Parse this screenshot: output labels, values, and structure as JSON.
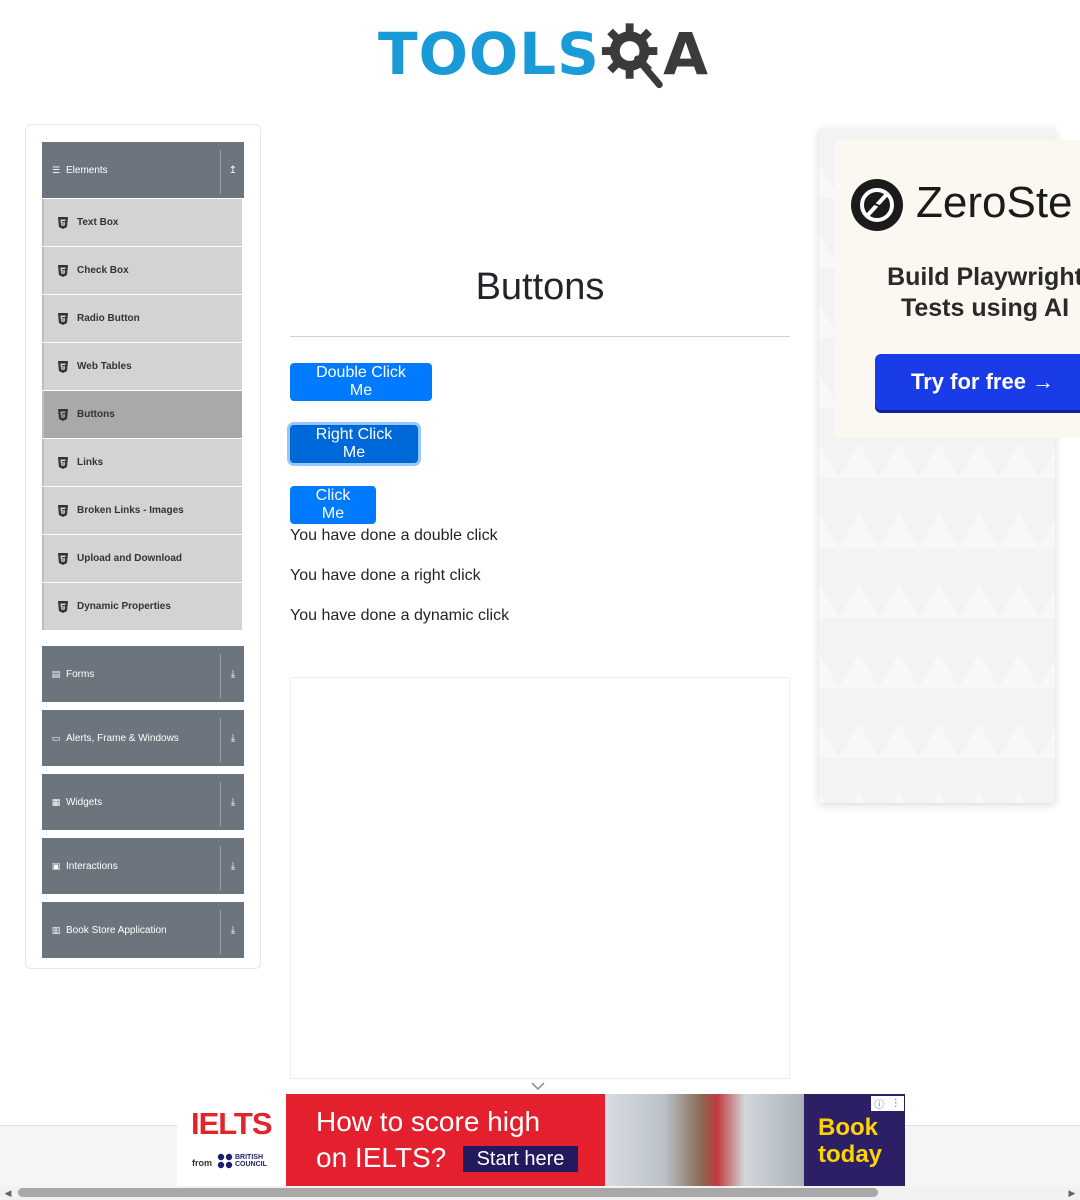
{
  "header": {
    "logo_text": "TOOLS",
    "logo_text_end": "A"
  },
  "sidebar": {
    "groups": [
      {
        "label": "Elements",
        "icon": "hamburger-icon",
        "arrow": "↥"
      },
      {
        "label": "Forms",
        "icon": "form-icon",
        "arrow": "⤓"
      },
      {
        "label": "Alerts, Frame & Windows",
        "icon": "window-icon",
        "arrow": "⤓"
      },
      {
        "label": "Widgets",
        "icon": "widgets-icon",
        "arrow": "⤓"
      },
      {
        "label": "Interactions",
        "icon": "interactions-icon",
        "arrow": "⤓"
      },
      {
        "label": "Book Store Application",
        "icon": "book-icon",
        "arrow": "⤓"
      }
    ],
    "items": [
      {
        "label": "Text Box"
      },
      {
        "label": "Check Box"
      },
      {
        "label": "Radio Button"
      },
      {
        "label": "Web Tables"
      },
      {
        "label": "Buttons"
      },
      {
        "label": "Links"
      },
      {
        "label": "Broken Links - Images"
      },
      {
        "label": "Upload and Download"
      },
      {
        "label": "Dynamic Properties"
      }
    ],
    "active_item": "Buttons"
  },
  "main": {
    "title": "Buttons",
    "buttons": {
      "double_click": "Double Click Me",
      "right_click": "Right Click Me",
      "click": "Click Me"
    },
    "messages": {
      "double": "You have done a double click",
      "right": "You have done a right click",
      "dynamic": "You have done a dynamic click"
    }
  },
  "right_ad": {
    "brand": "ZeroSte",
    "tagline_1": "Build Playwright",
    "tagline_2": "Tests using AI",
    "cta": "Try for free →"
  },
  "bottom_ad": {
    "logo": "IELTS",
    "from": "from",
    "council_1": "BRITISH",
    "council_2": "COUNCIL",
    "headline_1": "How to score high",
    "headline_2": "on IELTS?",
    "start": "Start here",
    "book_1": "Book",
    "book_2": "today",
    "adchoice_info": "ⓘ",
    "adchoice_menu": "⋮"
  },
  "colors": {
    "primary": "#007bff",
    "sidebar_header": "#6c757d",
    "logo_blue": "#1a9ad6",
    "ielts_red": "#e4202e"
  }
}
